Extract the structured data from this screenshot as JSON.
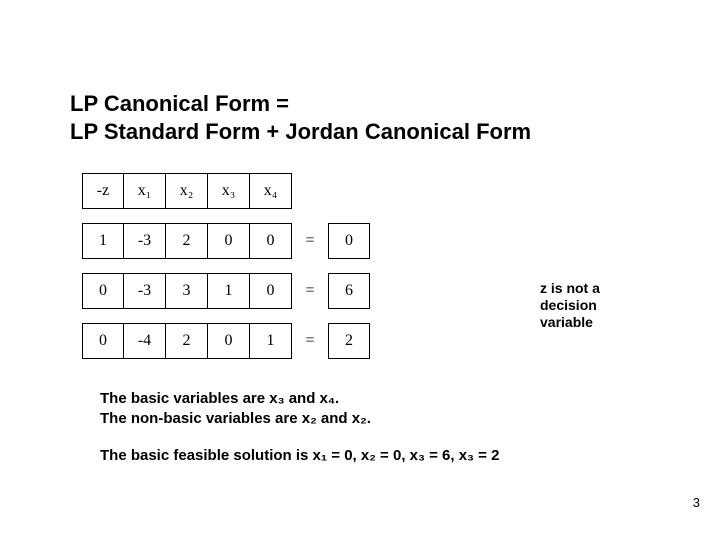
{
  "title_line1": "LP Canonical Form =",
  "title_line2": "LP Standard Form + Jordan Canonical Form",
  "chart_data": {
    "type": "table",
    "header": [
      "-z",
      "x₁",
      "x₂",
      "x₃",
      "x₄"
    ],
    "rows": [
      {
        "coeffs": [
          "1",
          "-3",
          "2",
          "0",
          "0"
        ],
        "eq": "=",
        "rhs": "0"
      },
      {
        "coeffs": [
          "0",
          "-3",
          "3",
          "1",
          "0"
        ],
        "eq": "=",
        "rhs": "6"
      },
      {
        "coeffs": [
          "0",
          "-4",
          "2",
          "0",
          "1"
        ],
        "eq": "=",
        "rhs": "2"
      }
    ]
  },
  "side_note": "z is not a decision variable",
  "note1": "The basic variables are x₃ and x₄.",
  "note2": "The non-basic variables are x₂ and x₂.",
  "note3": "The basic feasible solution is x₁ = 0, x₂ = 0, x₃ = 6, x₃ = 2",
  "page": "3"
}
